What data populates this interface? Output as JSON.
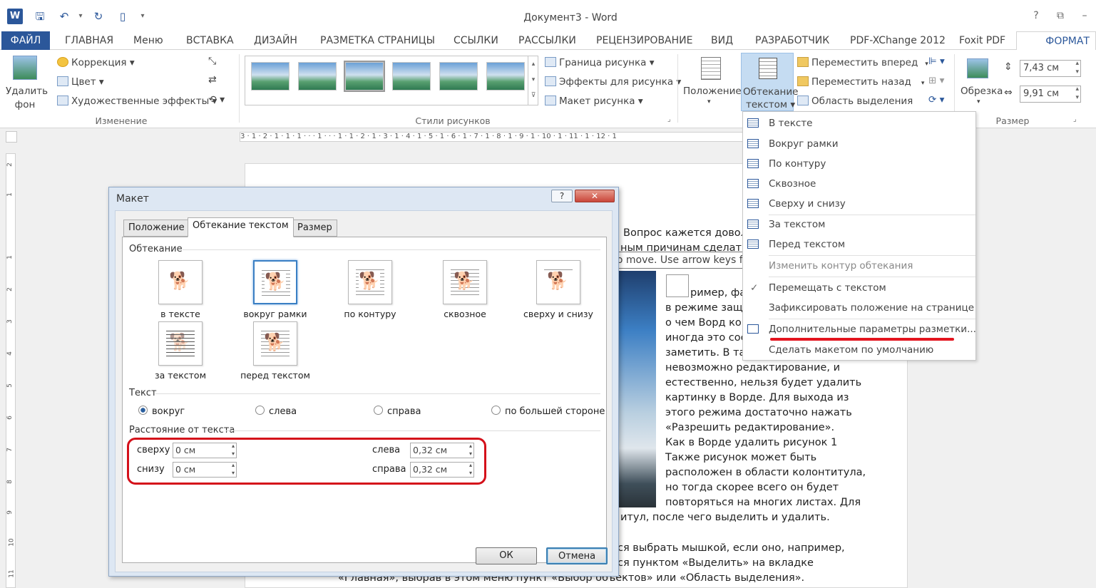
{
  "window": {
    "title": "Документ3 - Word",
    "help": "?"
  },
  "tabs": [
    "ФАЙЛ",
    "ГЛАВНАЯ",
    "Меню",
    "ВСТАВКА",
    "ДИЗАЙН",
    "РАЗМЕТКА СТРАНИЦЫ",
    "ССЫЛКИ",
    "РАССЫЛКИ",
    "РЕЦЕНЗИРОВАНИЕ",
    "ВИД",
    "РАЗРАБОТЧИК",
    "PDF-XChange 2012",
    "Foxit PDF",
    "ФОРМАТ"
  ],
  "ribbon": {
    "remove_bg": "Удалить\nфон",
    "remove_bg_1": "Удалить",
    "remove_bg_2": "фон",
    "correction": "Коррекция ▾",
    "color": "Цвет ▾",
    "art_effects": "Художественные эффекты ▾",
    "group_change": "Изменение",
    "picture_border": "Граница рисунка ▾",
    "picture_effects": "Эффекты для рисунка ▾",
    "picture_layout": "Макет рисунка ▾",
    "group_styles": "Стили рисунков",
    "position": "Положение",
    "wrap_1": "Обтекание",
    "wrap_2": "текстом ▾",
    "bring_forward": "Переместить вперед",
    "send_backward": "Переместить назад",
    "selection_pane": "Область выделения",
    "crop": "Обрезка",
    "height": "7,43 см",
    "width": "9,91 см",
    "group_size": "Размер"
  },
  "ruler": {
    "top": "3 · 1 · 2 · 1 · 1 · 1 · · · 1 · · · 1 · 1 · 2 · 1 · 3 · 1 · 4 · 1 · 5 · 1 · 6 · 1 · 7 · 1 · 8 · 1 · 9 · 1 · 10 · 1 · 11 · 1 · 12 · 1"
  },
  "ruler_left": [
    "2",
    "1",
    "1",
    "2",
    "3",
    "4",
    "5",
    "6",
    "7",
    "8",
    "9",
    "10",
    "11"
  ],
  "doc_lines": [
    "Вопрос кажется довол",
    "ным причинам сделать",
    "ример, фа",
    "в режиме защ",
    "о чем Ворд ко",
    "иногда это сос",
    "заметить. В та",
    "невозможно редактирование, и",
    "естественно, нельзя будет удалить",
    "картинку в Ворде. Для выхода из",
    "этого режима достаточно нажать",
    "«Разрешить редактирование».",
    "Как в Ворде удалить рисунок 1",
    "Также рисунок может быть",
    "расположен в области колонтитула,",
    "но тогда скорее всего он будет",
    "повторяться на многих листах. Для",
    "итул, после чего выделить и удалить.",
    "ся выбрать мышкой, если оно, например,",
    "ся пунктом «Выделить» на вкладке",
    "«Главная», выбрав в этом меню пункт «Выбор объектов» или «Область выделения»."
  ],
  "tooltip": "Click to close image, click and drag to move. Use arrow keys for next and previous.",
  "wrap_menu": {
    "items": [
      "В тексте",
      "Вокруг рамки",
      "По контуру",
      "Сквозное",
      "Сверху и снизу",
      "За текстом",
      "Перед текстом",
      "Изменить контур обтекания",
      "Перемещать с текстом",
      "Зафиксировать положение на странице",
      "Дополнительные параметры разметки...",
      "Сделать макетом по умолчанию"
    ],
    "check": "✓"
  },
  "dialog": {
    "title": "Макет",
    "help": "?",
    "close": "✕",
    "tabs": [
      "Положение",
      "Обтекание текстом",
      "Размер"
    ],
    "section_wrap": "Обтекание",
    "wrap_options": [
      "в тексте",
      "вокруг рамки",
      "по контуру",
      "сквозное",
      "сверху и снизу",
      "за текстом",
      "перед текстом"
    ],
    "section_text": "Текст",
    "text_options": [
      "вокруг",
      "слева",
      "справа",
      "по большей стороне"
    ],
    "section_distance": "Расстояние от текста",
    "distance": {
      "top_label": "сверху",
      "top": "0 см",
      "bottom_label": "снизу",
      "bottom": "0 см",
      "left_label": "слева",
      "left": "0,32 см",
      "right_label": "справа",
      "right": "0,32 см"
    },
    "ok": "ОК",
    "cancel": "Отмена"
  }
}
